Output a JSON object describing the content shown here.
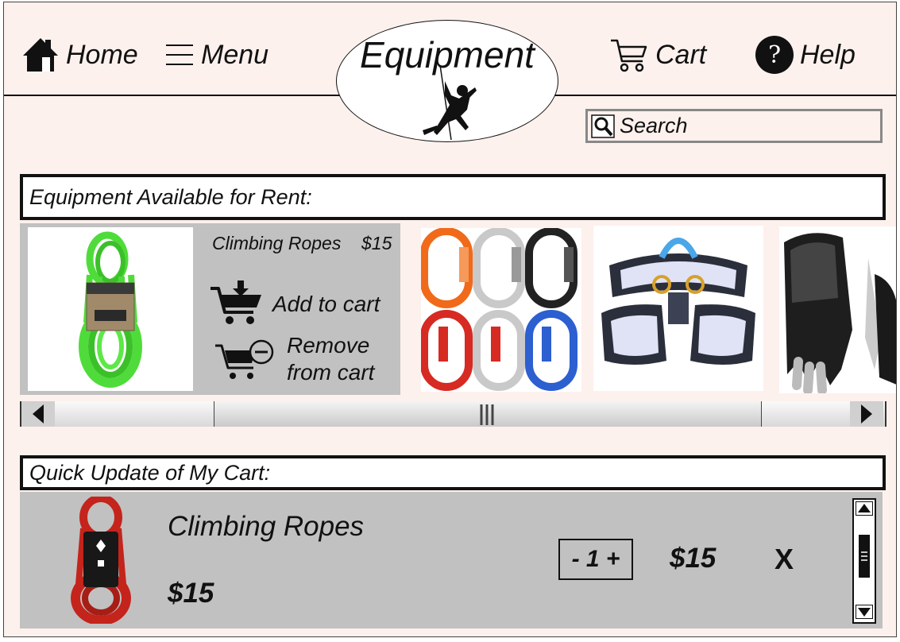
{
  "nav": {
    "home_label": "Home",
    "menu_label": "Menu",
    "cart_label": "Cart",
    "help_label": "Help",
    "help_glyph": "?"
  },
  "logo": {
    "title": "Equipment"
  },
  "search": {
    "placeholder": "Search"
  },
  "available": {
    "title": "Equipment Available for Rent:",
    "featured": {
      "name": "Climbing Ropes",
      "price": "$15",
      "add_label": "Add to cart",
      "remove_label_line1": "Remove",
      "remove_label_line2": "from cart"
    }
  },
  "cart": {
    "title": "Quick Update of My Cart:",
    "item": {
      "name": "Climbing Ropes",
      "unit_price": "$15",
      "quantity_text": "- 1 +",
      "line_total": "$15",
      "remove_glyph": "X"
    }
  },
  "icons": {
    "home": "home-icon",
    "menu": "hamburger-menu-icon",
    "cart": "shopping-cart-icon",
    "help": "question-mark-icon",
    "search": "magnifier-icon",
    "add_to_cart": "cart-add-icon",
    "remove_from_cart": "cart-remove-icon"
  },
  "colors": {
    "page_bg": "#fdf1ed",
    "panel_gray": "#c1c1c1",
    "rope_green": "#4fdc3a",
    "rope_red": "#c4241b"
  }
}
